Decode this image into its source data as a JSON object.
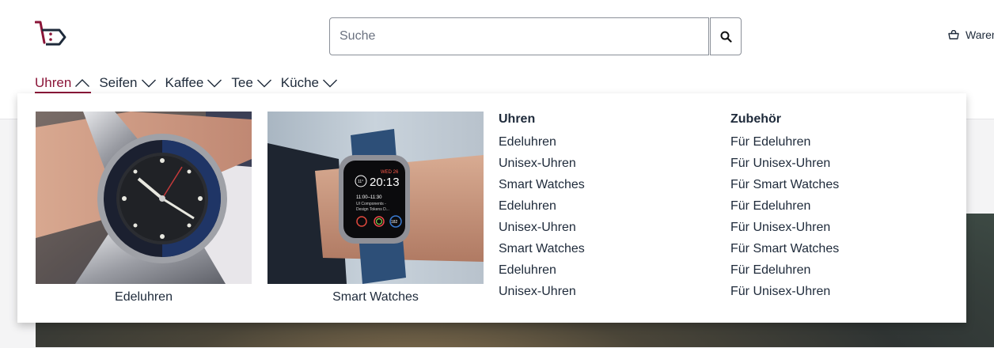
{
  "header": {
    "search_placeholder": "Suche",
    "cart_label": "Waren"
  },
  "nav": {
    "items": [
      {
        "label": "Uhren",
        "active": true
      },
      {
        "label": "Seifen"
      },
      {
        "label": "Kaffee"
      },
      {
        "label": "Tee"
      },
      {
        "label": "Küche"
      }
    ]
  },
  "dropdown": {
    "cards": [
      {
        "caption": "Edeluhren"
      },
      {
        "caption": "Smart Watches",
        "watch_day": "WED 26",
        "watch_time": "20:13",
        "watch_event_time": "11:00–11:30",
        "watch_event_line1": "UI Components -",
        "watch_event_line2": "Design Tokens D...",
        "watch_temp": "11°",
        "watch_steps": "182"
      }
    ],
    "columns": [
      {
        "title": "Uhren",
        "links": [
          "Edeluhren",
          "Unisex-Uhren",
          "Smart Watches",
          "Edeluhren",
          "Unisex-Uhren",
          "Smart Watches",
          "Edeluhren",
          "Unisex-Uhren"
        ]
      },
      {
        "title": "Zubehör",
        "links": [
          "Für Edeluhren",
          "Für Unisex-Uhren",
          "Für Smart Watches",
          "Für Edeluhren",
          "Für Unisex-Uhren",
          "Für Smart Watches",
          "Für Edeluhren",
          "Für Unisex-Uhren"
        ]
      }
    ]
  },
  "colors": {
    "accent": "#8b1538",
    "text": "#1e2a3a",
    "logo_dark": "#1e2a3a"
  },
  "icons": {
    "logo": "cart-face-logo",
    "search": "search-icon",
    "cart": "basket-icon",
    "chevron_up": "chevron-up-icon",
    "chevron_down": "chevron-down-icon"
  }
}
